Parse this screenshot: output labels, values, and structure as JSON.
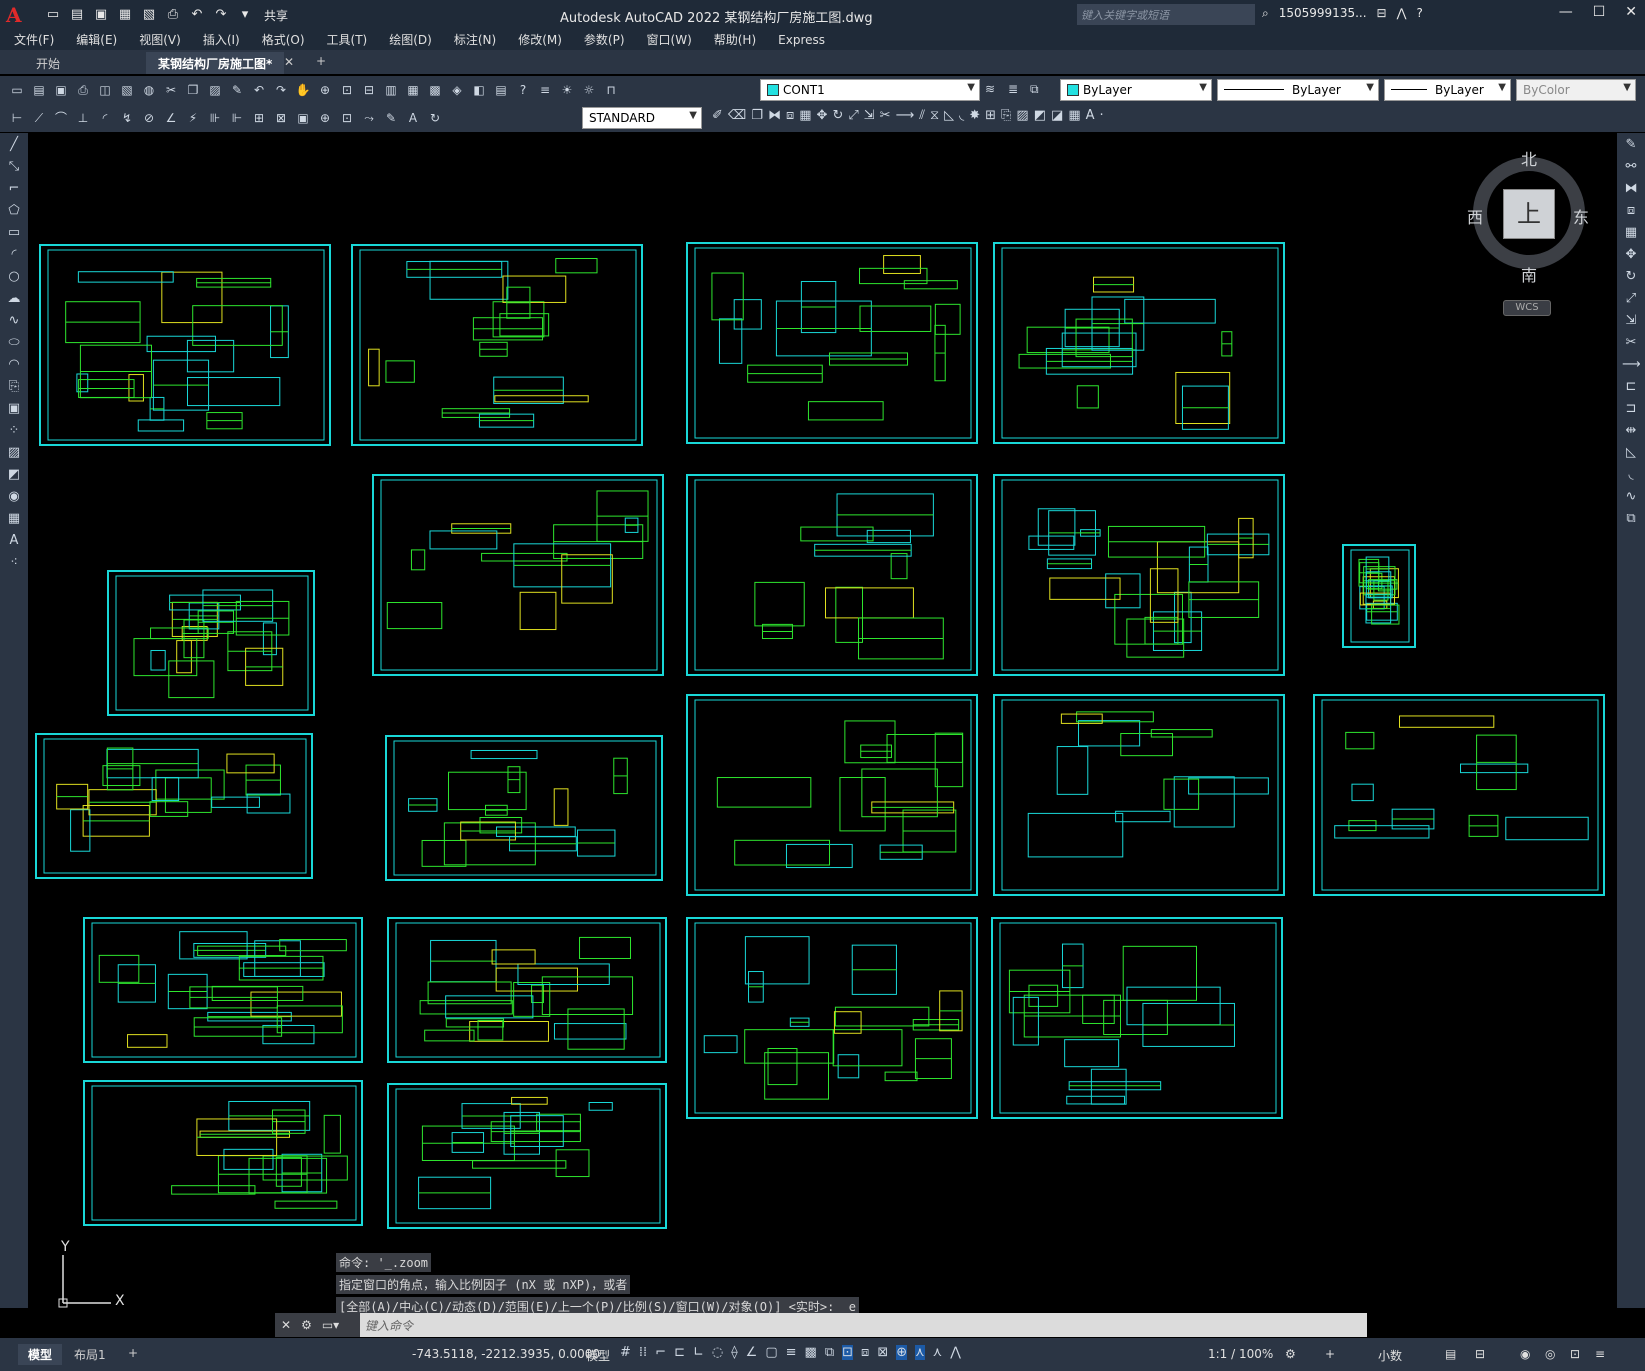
{
  "titlebar": {
    "logo": "A",
    "share_label": "共享",
    "app_title": "Autodesk AutoCAD 2022    某钢结构厂房施工图.dwg",
    "search_placeholder": "键入关键字或短语",
    "user": "1505999135...",
    "qat_icons": [
      "new-icon",
      "open-icon",
      "save-icon",
      "saveas-icon",
      "plot-icon",
      "undo-icon",
      "redo-icon"
    ]
  },
  "menu": [
    "文件(F)",
    "编辑(E)",
    "视图(V)",
    "插入(I)",
    "格式(O)",
    "工具(T)",
    "绘图(D)",
    "标注(N)",
    "修改(M)",
    "参数(P)",
    "窗口(W)",
    "帮助(H)",
    "Express"
  ],
  "tabs": {
    "start": "开始",
    "drawing": "某钢结构厂房施工图*",
    "add": "+"
  },
  "toolbar": {
    "layer": "CONT1",
    "color": "ByLayer",
    "linetype": "ByLayer",
    "lineweight": "ByLayer",
    "plotstyle": "ByColor",
    "textstyle": "STANDARD",
    "layer_color": "#22e0e0",
    "color_swatch": "#22e0e0"
  },
  "viewcube": {
    "north": "北",
    "south": "南",
    "east": "东",
    "west": "西",
    "top": "上",
    "wcs": "WCS"
  },
  "ucs": {
    "x": "X",
    "y": "Y"
  },
  "command": {
    "history": [
      "命令: '_.zoom",
      "指定窗口的角点，输入比例因子 (nX 或 nXP)，或者",
      "[全部(A)/中心(C)/动态(D)/范围(E)/上一个(P)/比例(S)/窗口(W)/对象(O)] <实时>: _e"
    ],
    "placeholder": "键入命令"
  },
  "status": {
    "model_tab": "模型",
    "layout_tab": "布局1",
    "add": "+",
    "coords": "-743.5118, -2212.3935, 0.0000",
    "space": "模型",
    "scale": "1:1 / 100%",
    "units": "小数"
  },
  "colors": {
    "sheet_border": "#19d8d8",
    "green": "#2ee62e",
    "yellow": "#e0e020",
    "accent": "#1c5aa6"
  }
}
